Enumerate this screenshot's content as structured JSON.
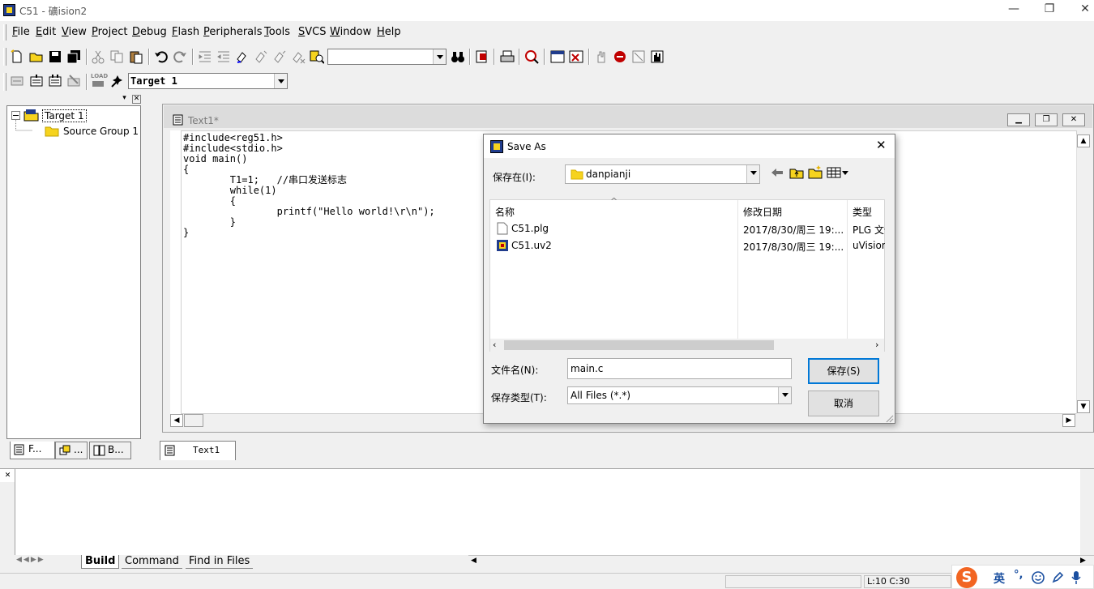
{
  "window": {
    "title": "C51  - 礦ision2",
    "minimize": "—",
    "restore": "❐",
    "close": "✕"
  },
  "menu": [
    {
      "key": "F",
      "rest": "ile"
    },
    {
      "key": "E",
      "rest": "dit"
    },
    {
      "key": "V",
      "rest": "iew"
    },
    {
      "key": "P",
      "rest": "roject"
    },
    {
      "key": "D",
      "rest": "ebug"
    },
    {
      "key": "F",
      "rest": "lash",
      "keypos": "l"
    },
    {
      "key": "P",
      "rest": "eripherals"
    },
    {
      "key": "T",
      "rest": "ools"
    },
    {
      "key": "S",
      "rest": "VCS"
    },
    {
      "key": "W",
      "rest": "indow"
    },
    {
      "key": "H",
      "rest": "elp"
    }
  ],
  "toolbar2": {
    "target_value": "Target 1",
    "load_label": "LOAD"
  },
  "project_tree": {
    "root": "Target 1",
    "group": "Source Group 1"
  },
  "left_tabs": [
    "F...",
    "...",
    "B..."
  ],
  "editor": {
    "title": "Text1*",
    "tab_label": "Text1",
    "code": "#include<reg51.h>\n#include<stdio.h>\nvoid main()\n{\n\tT1=1;   //串口发送标志\n\twhile(1)\n\t{\n\t\tprintf(\"Hello world!\\r\\n\");\n\t}\n}"
  },
  "output_tabs": [
    "Build",
    "Command",
    "Find in Files"
  ],
  "status": {
    "position": "L:10 C:30"
  },
  "save_dialog": {
    "title": "Save As",
    "save_in_label": "保存在(I):",
    "save_in_value": "danpianji",
    "columns": [
      "名称",
      "修改日期",
      "类型"
    ],
    "files": [
      {
        "name": "C51.plg",
        "date": "2017/8/30/周三 19:...",
        "type": "PLG 文件"
      },
      {
        "name": "C51.uv2",
        "date": "2017/8/30/周三 19:...",
        "type": "uVision"
      }
    ],
    "filename_label": "文件名(N):",
    "filename_value": "main.c",
    "filetype_label": "保存类型(T):",
    "filetype_value": "All Files (*.*)",
    "save_button": "保存(S)",
    "cancel_button": "取消"
  },
  "tray": {
    "ime": "英",
    "punct": "°,",
    "sogou": "S"
  },
  "colors": {
    "accent": "#0078d7",
    "app_icon_bg": "#203c8c",
    "folder": "#f6d31e"
  }
}
